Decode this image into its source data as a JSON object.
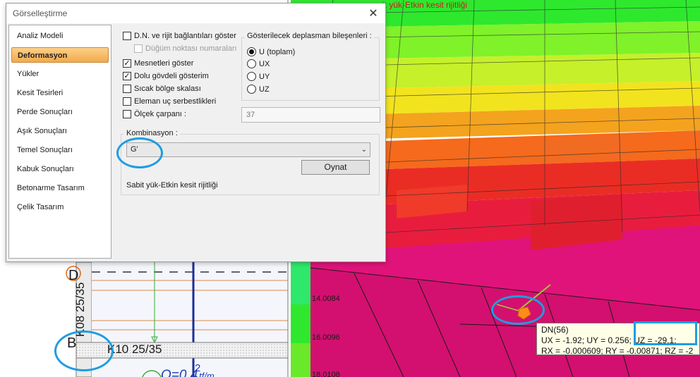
{
  "dialog": {
    "title": "Görselleştirme",
    "nav": [
      {
        "label": "Analiz Modeli"
      },
      {
        "label": "Deformasyon"
      },
      {
        "label": "Yükler"
      },
      {
        "label": "Kesit Tesirleri"
      },
      {
        "label": "Perde Sonuçları"
      },
      {
        "label": "Aşık Sonuçları"
      },
      {
        "label": "Temel Sonuçları"
      },
      {
        "label": "Kabuk Sonuçları"
      },
      {
        "label": "Betonarme Tasarım"
      },
      {
        "label": "Çelik Tasarım"
      }
    ],
    "active_nav": "Deformasyon",
    "options": [
      {
        "label": "D.N. ve rijit bağlantıları göster",
        "checked": false,
        "enabled": true
      },
      {
        "label": "Düğüm noktası numaraları",
        "checked": false,
        "enabled": false
      },
      {
        "label": "Mesnetleri göster",
        "checked": true,
        "enabled": true
      },
      {
        "label": "Dolu gövdeli gösterim",
        "checked": true,
        "enabled": true
      },
      {
        "label": "Sıcak bölge skalası",
        "checked": false,
        "enabled": true
      },
      {
        "label": "Eleman uç serbestlikleri",
        "checked": false,
        "enabled": true
      },
      {
        "label": "Ölçek çarpanı :",
        "checked": false,
        "enabled": true
      }
    ],
    "displacement_group": {
      "title": "Gösterilecek deplasman bileşenleri :",
      "options": [
        {
          "label": "U (toplam)",
          "selected": true
        },
        {
          "label": "UX",
          "selected": false
        },
        {
          "label": "UY",
          "selected": false
        },
        {
          "label": "UZ",
          "selected": false
        }
      ]
    },
    "scale_factor_value": "37",
    "combination": {
      "title": "Kombinasyon :",
      "selected": "G'",
      "show_button": "Oynat",
      "note": "Sabit yük-Etkin kesit rijitliği"
    },
    "close_glyph": "✕"
  },
  "view3d": {
    "caption": "it yük-Etkin kesit rijitliği",
    "legend": [
      "14.0084",
      "16.0096",
      "18.0108"
    ],
    "tooltip": {
      "line1": "DN(56)",
      "line2": "UX = -1.92; UY = 0.256; UZ = -29.1;",
      "line3": "RX = -0.000609; RY = -0.00871; RZ = -2"
    }
  },
  "cad": {
    "beam_vertical": "K08 25/35",
    "beam_horizontal": "K10 25/35",
    "letter_d": "D",
    "letter_b": "B",
    "load_label": "Q=0.4",
    "load_unit": "tf/m",
    "load_superscript": "2"
  },
  "colors": {
    "accent_annotation": "#1f9de0",
    "active_nav": "#f3a94a",
    "magenta_slab": "#e0137a"
  }
}
